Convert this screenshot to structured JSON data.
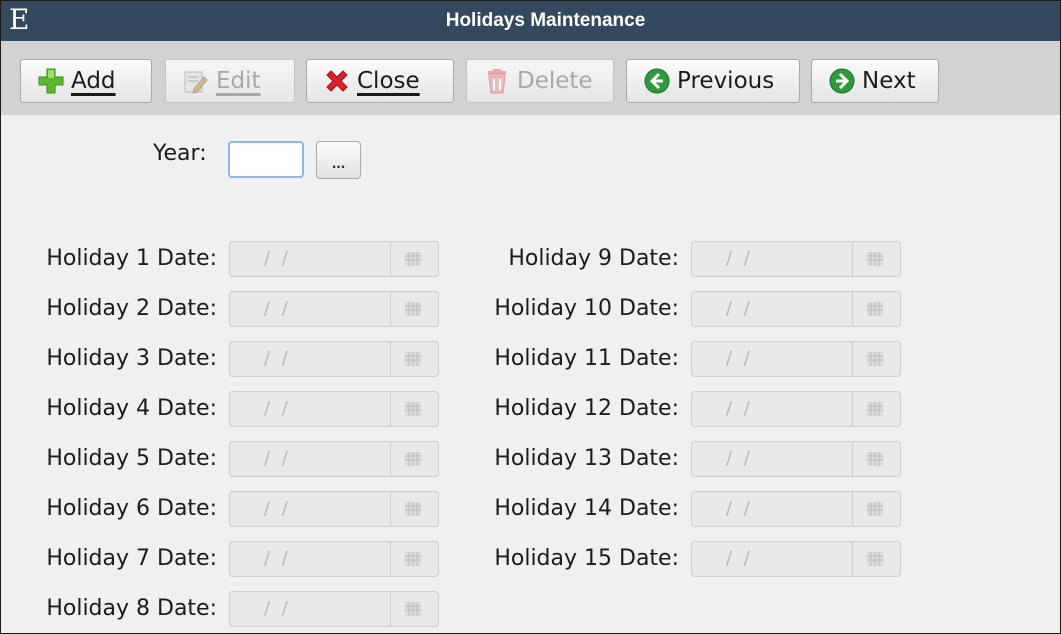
{
  "window": {
    "title": "Holidays Maintenance",
    "logo": "E"
  },
  "toolbar": {
    "add_label": "Add",
    "edit_label": "Edit",
    "close_label": "Close",
    "delete_label": "Delete",
    "previous_label": "Previous",
    "next_label": "Next",
    "icons": [
      "plus-icon",
      "edit-icon",
      "close-x-icon",
      "trash-icon",
      "arrow-left-icon",
      "arrow-right-icon"
    ]
  },
  "year": {
    "label": "Year:",
    "value": "",
    "lookup_label": "..."
  },
  "holidays": {
    "date_mask": "/ /",
    "labels": [
      "Holiday 1 Date:",
      "Holiday 2 Date:",
      "Holiday 3 Date:",
      "Holiday 4 Date:",
      "Holiday 5 Date:",
      "Holiday 6 Date:",
      "Holiday 7 Date:",
      "Holiday 8 Date:",
      "Holiday 9 Date:",
      "Holiday 10 Date:",
      "Holiday 11 Date:",
      "Holiday 12 Date:",
      "Holiday 13 Date:",
      "Holiday 14 Date:",
      "Holiday 15 Date:"
    ]
  },
  "colors": {
    "titlebar": "#34495e",
    "toolbar": "#d2d2d2",
    "add_green": "#5cb82e",
    "close_red": "#d8232a",
    "nav_green": "#2e9a3e"
  }
}
